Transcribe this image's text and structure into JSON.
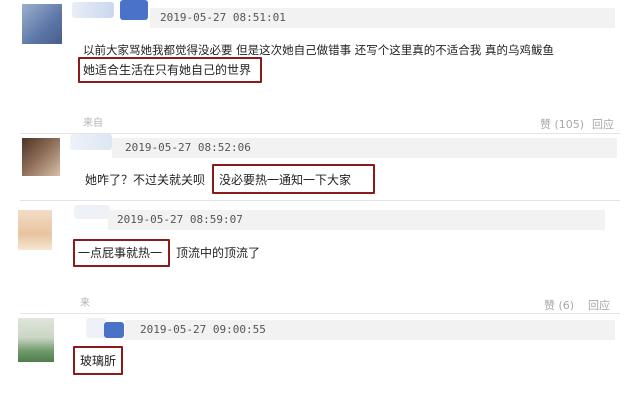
{
  "comments": [
    {
      "timestamp": "2019-05-27 08:51:01",
      "line1": "以前大家骂她我都觉得没必要 但是这次她自己做错事 还写个这里真的不适合我 真的乌鸡鲅鱼",
      "line2": "她适合生活在只有她自己的世界",
      "from": "来自",
      "likes": "赞 (105)",
      "reply": "回应"
    },
    {
      "timestamp": "2019-05-27 08:52:06",
      "text_a": "她咋了？不过关就关呗",
      "text_b": "没必要热一通知一下大家"
    },
    {
      "timestamp": "2019-05-27 08:59:07",
      "text_a": "一点屁事就热一",
      "text_b": "顶流中的顶流了",
      "from": "来",
      "likes": "赞 (6)",
      "reply": "回应"
    },
    {
      "timestamp": "2019-05-27 09:00:55",
      "text": "玻璃肵"
    }
  ],
  "colors": {
    "highlight": "#8b1a1a",
    "header_bar": "#f2f2f2"
  }
}
